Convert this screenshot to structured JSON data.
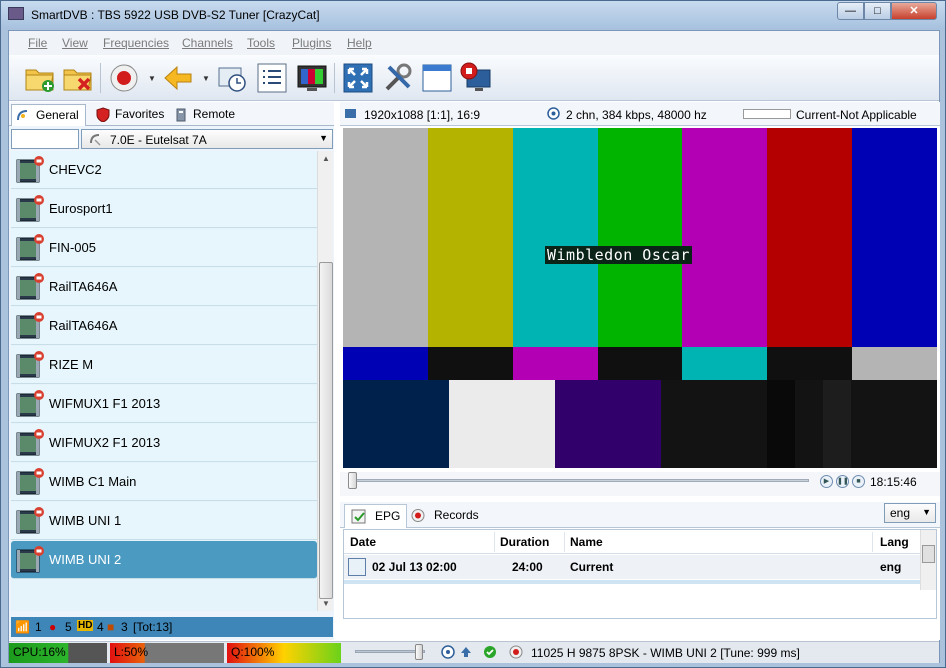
{
  "window": {
    "title": "SmartDVB : TBS 5922 USB DVB-S2 Tuner [CrazyCat]",
    "buttons": {
      "minimize": "—",
      "maximize": "□",
      "close": "✕"
    }
  },
  "menu": [
    "File",
    "View",
    "Frequencies",
    "Channels",
    "Tools",
    "Plugins",
    "Help"
  ],
  "toolbar": {
    "icons": [
      "open-folder-icon",
      "close-folder-icon",
      "record-icon",
      "back-arrow-icon",
      "scheduler-icon",
      "list-icon",
      "tv-monitor-icon",
      "fullscreen-icon",
      "tools-icon",
      "window-icon",
      "stop-record-monitor-icon"
    ]
  },
  "left_tabs": [
    "General",
    "Favorites",
    "Remote"
  ],
  "satellite": {
    "search_value": "",
    "selected": "7.0E -  Eutelsat 7A"
  },
  "channels": [
    {
      "name": "CHEVC2",
      "selected": false
    },
    {
      "name": "Eurosport1",
      "selected": false
    },
    {
      "name": "FIN-005",
      "selected": false
    },
    {
      "name": "RailTA646A",
      "selected": false
    },
    {
      "name": "RailTA646A",
      "selected": false
    },
    {
      "name": "RIZE M",
      "selected": false
    },
    {
      "name": "WIFMUX1 F1 2013",
      "selected": false
    },
    {
      "name": "WIFMUX2 F1 2013",
      "selected": false
    },
    {
      "name": "WIMB C1 Main",
      "selected": false
    },
    {
      "name": "WIMB UNI 1",
      "selected": false
    },
    {
      "name": "WIMB UNI 2",
      "selected": true
    }
  ],
  "left_status": {
    "count1": "1",
    "count2": "5",
    "hd_label": "HD",
    "count3": "4",
    "count4": "3",
    "total": "[Tot:13]"
  },
  "video_info": {
    "resolution": "1920x1088 [1:1], 16:9",
    "audio": "2 chn, 384 kbps, 48000 hz",
    "signal_level": 0,
    "signal_status": "Current-Not Applicable"
  },
  "video": {
    "overlay_text": "Wimbledon Oscar",
    "top_bars": [
      "#b4b4b4",
      "#b4b400",
      "#00b4b4",
      "#00b400",
      "#b400b4",
      "#b40000",
      "#0000b4"
    ],
    "mid_bars": [
      "#0000b4",
      "#101010",
      "#b400b4",
      "#101010",
      "#00b4b4",
      "#101010",
      "#b4b4b4"
    ],
    "bottom_bars": [
      "#00214c",
      "#ebebeb",
      "#32006a",
      "#131313",
      "#090909",
      "#131313",
      "#1d1d1d",
      "#131313"
    ]
  },
  "playback": {
    "progress": 0,
    "time": "18:15:46"
  },
  "lower_tabs": [
    "EPG",
    "Records"
  ],
  "lang": {
    "selected": "eng"
  },
  "epg": {
    "columns": [
      "Date",
      "Duration",
      "Name",
      "Lang"
    ],
    "rows": [
      {
        "date": "02 Jul 13 02:00",
        "duration": "24:00",
        "name": "Current",
        "lang": "eng"
      }
    ]
  },
  "status": {
    "cpu": "CPU:16%",
    "load": "L:50%",
    "quality": "Q:100%",
    "volume": 0.85,
    "tune": "11025 H 9875 8PSK - WIMB UNI 2 [Tune: 999 ms]"
  }
}
